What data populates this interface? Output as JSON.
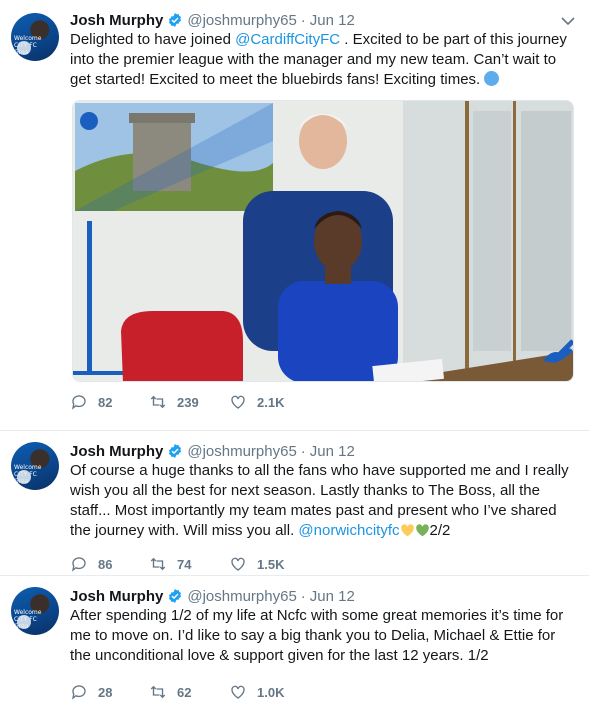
{
  "tweets": [
    {
      "name": "Josh Murphy",
      "handle": "@joshmurphy65",
      "date": "Jun 12",
      "text_before": "Delighted to have joined ",
      "mention": "@CardiffCityFC",
      "text_after": " . Excited to be part of this journey into the premier league with the manager and my new team. Can’t wait to get started! Excited to meet the bluebirds fans! Exciting times.",
      "replies": "82",
      "retweets": "239",
      "likes": "2.1K"
    },
    {
      "name": "Josh Murphy",
      "handle": "@joshmurphy65",
      "date": "Jun 12",
      "text_before": "Of course a huge thanks to all the fans who have supported me and I really wish you all the best for next season. Lastly thanks to The Boss, all the staff... Most importantly my team mates past and present who I’ve shared the journey with. Will miss you all. ",
      "mention": "@norwichcityfc",
      "text_after": "2/2",
      "replies": "86",
      "retweets": "74",
      "likes": "1.5K"
    },
    {
      "name": "Josh Murphy",
      "handle": "@joshmurphy65",
      "date": "Jun 12",
      "text": "After spending 1/2 of my life at Ncfc with some great memories it’s time for me to move on. I’d like to say a big thank you to Delia, Michael & Ettie for the unconditional love & support given for the last 12 years. 1/2",
      "replies": "28",
      "retweets": "62",
      "likes": "1.0K"
    }
  ],
  "avatar_caption": "Welcome\nCITY FC\nGrea",
  "colors": {
    "link": "#1b95e0",
    "muted": "#657786",
    "verified": "#1da1f2",
    "divider": "#e6ecf0"
  }
}
